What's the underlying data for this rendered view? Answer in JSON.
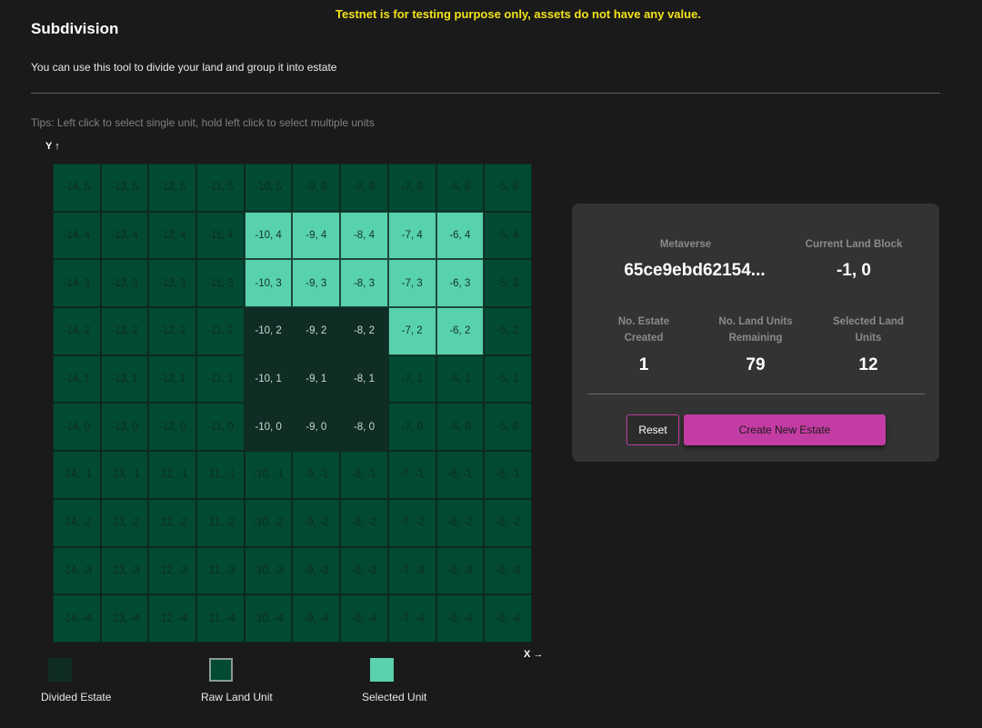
{
  "banner": "Testnet is for testing purpose only, assets do not have any value.",
  "page": {
    "title": "Subdivision",
    "description": "You can use this tool to divide your land and group it into estate",
    "tips": "Tips: Left click to select single unit, hold left click to select multiple units"
  },
  "axes": {
    "y_label": "Y",
    "x_label": "X"
  },
  "grid": {
    "x_values": [
      -14,
      -13,
      -12,
      -11,
      -10,
      -9,
      -8,
      -7,
      -6,
      -5
    ],
    "y_values": [
      5,
      4,
      3,
      2,
      1,
      0,
      -1,
      -2,
      -3,
      -4
    ],
    "selected_units": [
      "-10, 4",
      "-9, 4",
      "-8, 4",
      "-7, 4",
      "-6, 4",
      "-10, 3",
      "-9, 3",
      "-8, 3",
      "-7, 3",
      "-6, 3",
      "-7, 2",
      "-6, 2"
    ],
    "divided_units": [
      "-10, 2",
      "-9, 2",
      "-8, 2",
      "-10, 1",
      "-9, 1",
      "-8, 1",
      "-10, 0",
      "-9, 0",
      "-8, 0"
    ]
  },
  "legend": {
    "divided": "Divided Estate",
    "raw": "Raw Land Unit",
    "selected": "Selected Unit"
  },
  "colors": {
    "raw": "#024a33",
    "divided": "#0f2c25",
    "selected": "#58d1ad",
    "accent": "#c33ca3",
    "banner": "#f2e21c"
  },
  "panel": {
    "metaverse_label": "Metaverse",
    "metaverse_value": "65ce9ebd62154...",
    "land_block_label": "Current Land Block",
    "land_block_value": "-1, 0",
    "estates_created_label_1": "No. Estate",
    "estates_created_label_2": "Created",
    "estates_created_value": "1",
    "remaining_label_1": "No. Land Units",
    "remaining_label_2": "Remaining",
    "remaining_value": "79",
    "selected_label_1": "Selected Land",
    "selected_label_2": "Units",
    "selected_value": "12",
    "reset_label": "Reset",
    "create_label": "Create New Estate"
  }
}
